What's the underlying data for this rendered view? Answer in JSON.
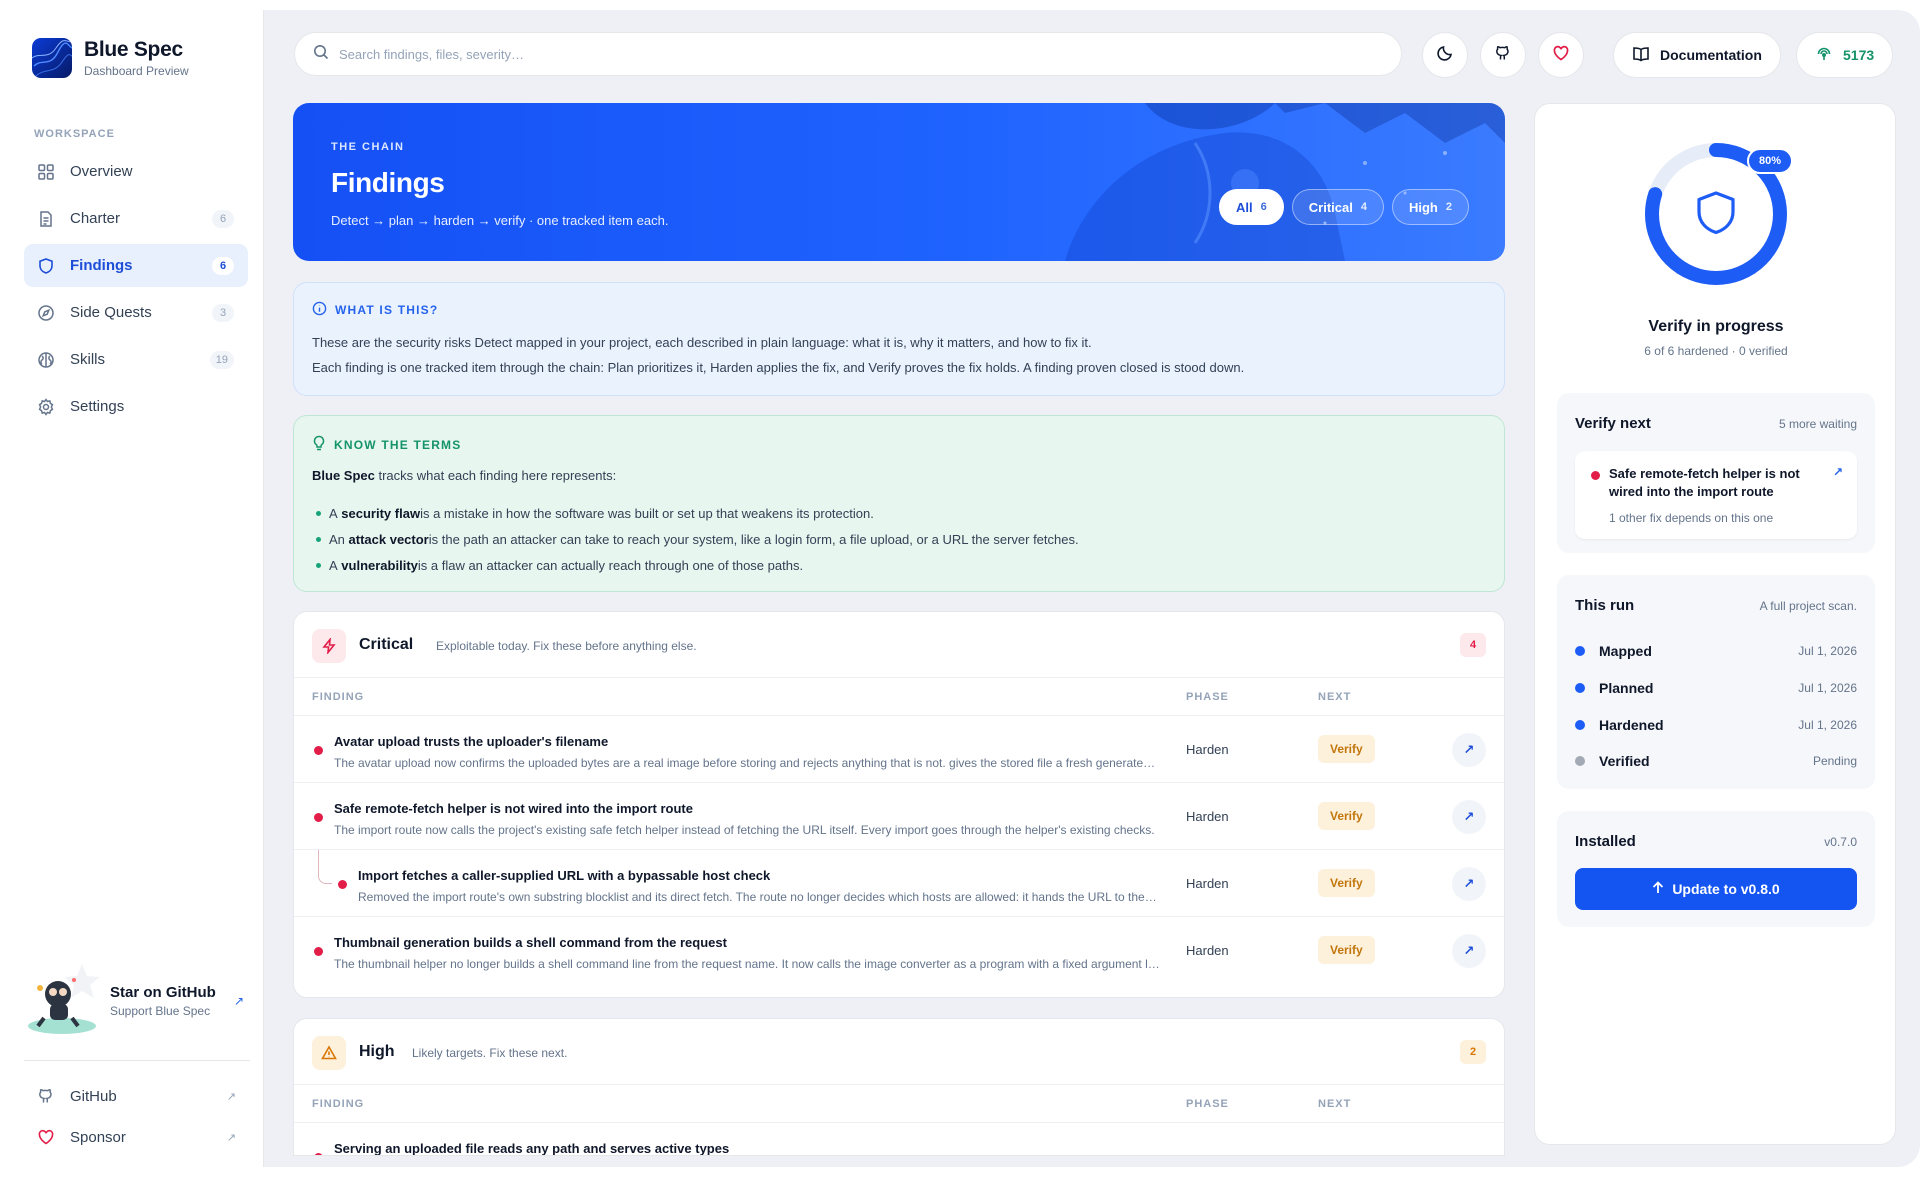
{
  "brand": {
    "name": "Blue Spec",
    "subtitle": "Dashboard Preview"
  },
  "sidebar": {
    "section_label": "WORKSPACE",
    "items": [
      {
        "label": "Overview",
        "count": null,
        "icon": "grid-icon"
      },
      {
        "label": "Charter",
        "count": "6",
        "icon": "document-icon"
      },
      {
        "label": "Findings",
        "count": "6",
        "icon": "shield-icon",
        "active": true
      },
      {
        "label": "Side Quests",
        "count": "3",
        "icon": "compass-icon"
      },
      {
        "label": "Skills",
        "count": "19",
        "icon": "brain-icon"
      },
      {
        "label": "Settings",
        "count": null,
        "icon": "gear-icon"
      }
    ],
    "star": {
      "title": "Star on GitHub",
      "subtitle": "Support Blue Spec",
      "arrow": "↗"
    },
    "footer": [
      {
        "label": "GitHub",
        "arrow": "↗"
      },
      {
        "label": "Sponsor",
        "arrow": "↗"
      }
    ]
  },
  "topbar": {
    "search_placeholder": "Search findings, files, severity…",
    "documentation_label": "Documentation",
    "port_label": "5173"
  },
  "hero": {
    "kicker": "THE CHAIN",
    "title": "Findings",
    "subtitle": "Detect → plan → harden → verify · one tracked item each.",
    "filters": [
      {
        "label": "All",
        "count": "6",
        "active": true
      },
      {
        "label": "Critical",
        "count": "4"
      },
      {
        "label": "High",
        "count": "2"
      }
    ]
  },
  "info": {
    "kicker": "WHAT IS THIS?",
    "line1": "These are the security risks Detect mapped in your project, each described in plain language: what it is, why it matters, and how to fix it.",
    "line2": "Each finding is one tracked item through the chain: Plan prioritizes it, Harden applies the fix, and Verify proves the fix holds. A finding proven closed is stood down."
  },
  "terms": {
    "kicker": "KNOW THE TERMS",
    "intro_bold": "Blue Spec",
    "intro_rest": " tracks what each finding here represents:",
    "items": [
      {
        "pre": "A ",
        "bold": "security flaw",
        "post": " is a mistake in how the software was built or set up that weakens its protection."
      },
      {
        "pre": "An ",
        "bold": "attack vector",
        "post": " is the path an attacker can take to reach your system, like a login form, a file upload, or a URL the server fetches."
      },
      {
        "pre": "A ",
        "bold": "vulnerability",
        "post": " is a flaw an attacker can actually reach through one of those paths."
      }
    ]
  },
  "table_headers": {
    "finding": "FINDING",
    "phase": "PHASE",
    "next": "NEXT"
  },
  "critical": {
    "title": "Critical",
    "description": "Exploitable today. Fix these before anything else.",
    "count": "4",
    "rows": [
      {
        "title": "Avatar upload trusts the uploader's filename",
        "desc": "The avatar upload now confirms the uploaded bytes are a real image before storing and rejects anything that is not. gives the stored file a fresh generated name.",
        "phase": "Harden",
        "next": "Verify"
      },
      {
        "title": "Safe remote-fetch helper is not wired into the import route",
        "desc": "The import route now calls the project's existing safe fetch helper instead of fetching the URL itself. Every import goes through the helper's existing checks.",
        "phase": "Harden",
        "next": "Verify"
      },
      {
        "title": "Import fetches a caller-supplied URL with a bypassable host check",
        "desc": "Removed the import route's own substring blocklist and its direct fetch. The route no longer decides which hosts are allowed: it hands the URL to the helper.",
        "phase": "Harden",
        "next": "Verify",
        "sub": true
      },
      {
        "title": "Thumbnail generation builds a shell command from the request",
        "desc": "The thumbnail helper no longer builds a shell command line from the request name. It now calls the image converter as a program with a fixed argument list.",
        "phase": "Harden",
        "next": "Verify"
      }
    ]
  },
  "high": {
    "title": "High",
    "description": "Likely targets. Fix these next.",
    "count": "2",
    "rows": [
      {
        "title": "Serving an uploaded file reads any path and serves active types"
      }
    ]
  },
  "progress": {
    "percent": 80,
    "percent_label": "80%",
    "title": "Verify in progress",
    "subtitle": "6 of 6 hardened · 0 verified"
  },
  "verify_next": {
    "title": "Verify next",
    "meta": "5 more waiting",
    "item_title": "Safe remote-fetch helper is not wired into the import route",
    "item_sub": "1 other fix depends on this one"
  },
  "this_run": {
    "title": "This run",
    "meta": "A full project scan.",
    "steps": [
      {
        "label": "Mapped",
        "date": "Jul 1, 2026"
      },
      {
        "label": "Planned",
        "date": "Jul 1, 2026"
      },
      {
        "label": "Hardened",
        "date": "Jul 1, 2026"
      },
      {
        "label": "Verified",
        "date": "Pending"
      }
    ]
  },
  "installed": {
    "title": "Installed",
    "version": "v0.7.0",
    "update_label": "Update to v0.8.0"
  },
  "colors": {
    "accent": "#1454f1",
    "critical": "#e11d48",
    "high": "#d97706",
    "verify_badge": "#fdf1dc"
  }
}
